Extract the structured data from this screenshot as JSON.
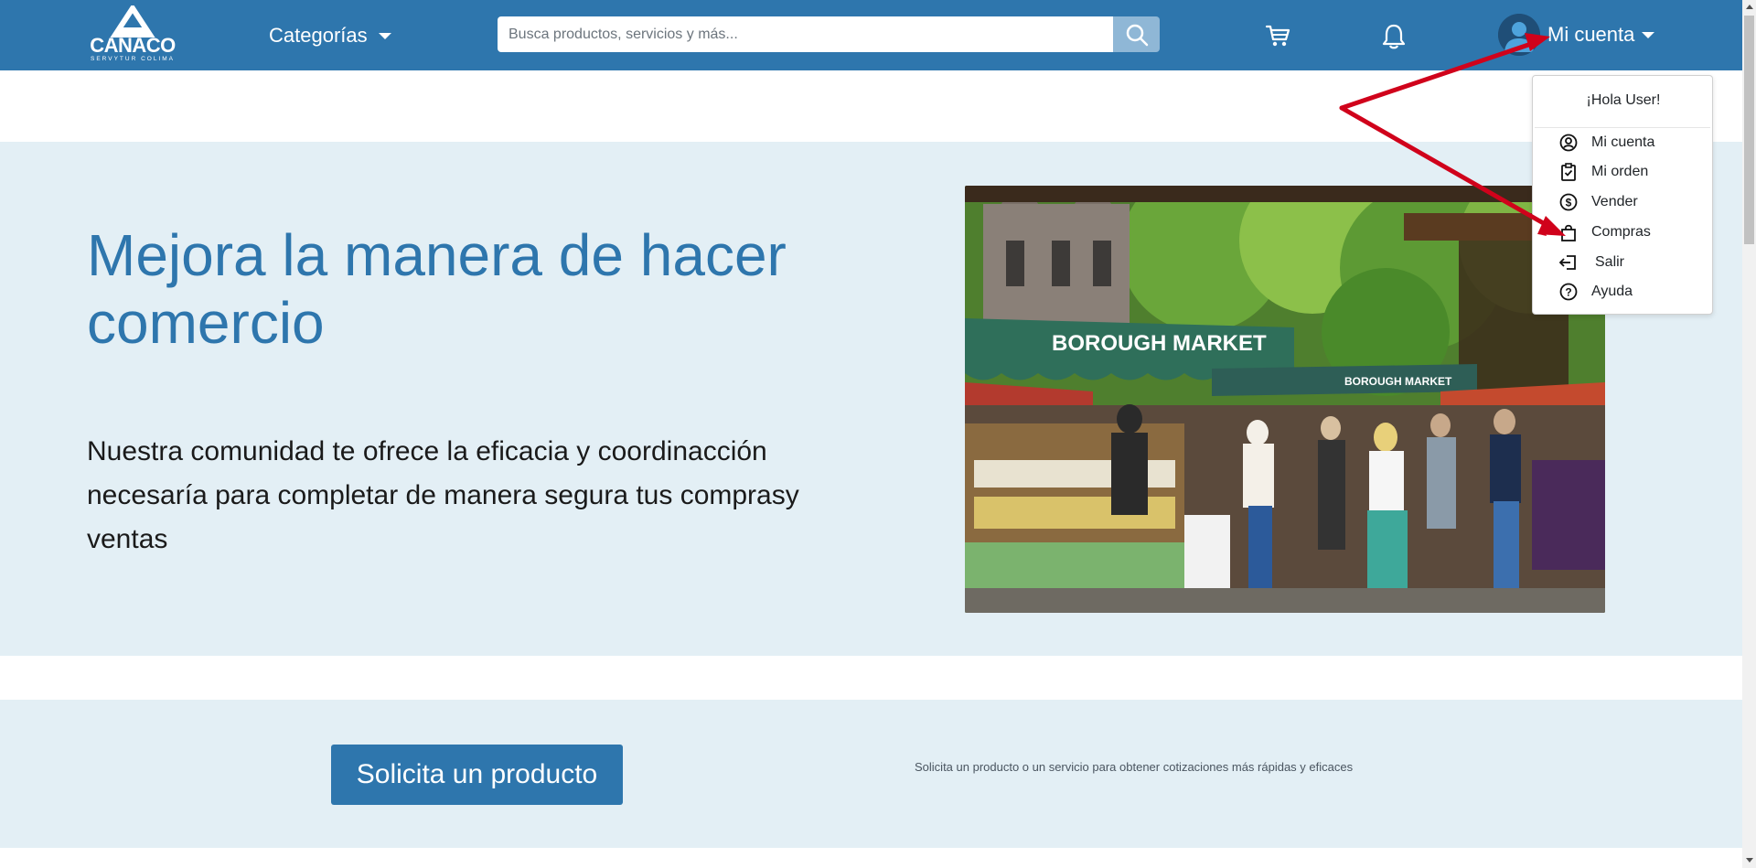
{
  "header": {
    "logo_text": "CANACO",
    "logo_subtext": "SERVYTUR COLIMA",
    "categories_label": "Categorías",
    "search": {
      "placeholder": "Busca productos, servicios y más...",
      "value": ""
    },
    "account_label": "Mi cuenta"
  },
  "account_menu": {
    "greeting": "¡Hola User!",
    "items": [
      {
        "label": "Mi cuenta",
        "icon": "user-circle-icon"
      },
      {
        "label": "Mi orden",
        "icon": "clipboard-check-icon"
      },
      {
        "label": "Vender",
        "icon": "dollar-circle-icon"
      },
      {
        "label": "Compras",
        "icon": "shopping-bag-icon"
      },
      {
        "label": "Salir",
        "icon": "logout-icon"
      },
      {
        "label": "Ayuda",
        "icon": "help-circle-icon"
      }
    ]
  },
  "hero": {
    "title": "Mejora la manera de hacer comercio",
    "text": "Nuestra comunidad te ofrece la eficacia y coordinacción necesaría para completar de manera segura tus comprasy ventas",
    "image_sign_main": "BOROUGH MARKET",
    "image_sign_small": "BOROUGH MARKET"
  },
  "cta": {
    "button_label": "Solicita un producto",
    "note": "Solicita un producto o un servicio para obtener cotizaciones más rápidas y eficaces"
  },
  "colors": {
    "primary": "#2e76ad",
    "hero_bg": "#e3eff5",
    "annotation_arrow": "#d0021b"
  }
}
